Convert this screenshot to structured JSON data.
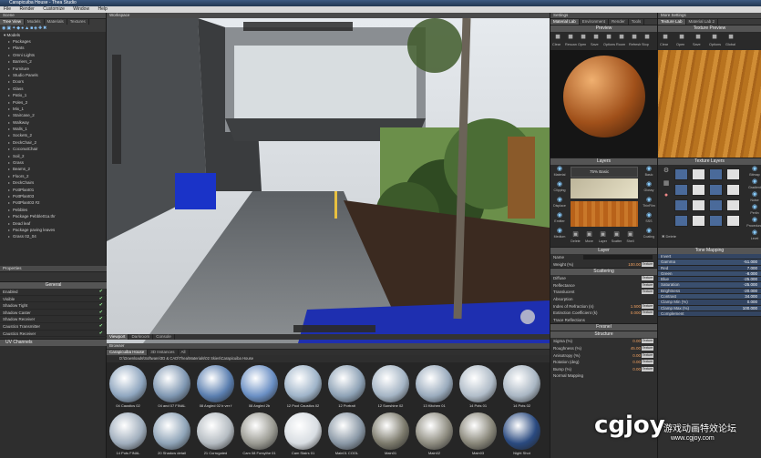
{
  "window": {
    "title": "Carapicuiba House - Thea Studio"
  },
  "menu": [
    "File",
    "Render",
    "Customize",
    "Window",
    "Help"
  ],
  "left": {
    "tabs": [
      "Tree View",
      "Models",
      "Materials",
      "Textures"
    ],
    "root": "Models",
    "items": [
      "Packages",
      "Plants",
      "Omni Lights",
      "Barriers_2",
      "Furniture",
      "Studio Panels",
      "Doors",
      "Glass",
      "Patio_1",
      "Poles_2",
      "Mix_1",
      "Staircase_2",
      "Walkway",
      "Walls_1",
      "Sockets_2",
      "DeckChair_2",
      "CoconutChair",
      "Soil_2",
      "Grass",
      "Beams_2",
      "Floors_2",
      "DeckChairs",
      "PottPlant01",
      "PottPlant03",
      "PottPlant03 #2",
      "Pebbles",
      "Package Pebble01a.thr",
      "Dead leaf",
      "Package paving leaves",
      "Grass 02_04"
    ],
    "properties_title": "Properties",
    "general_header": "General",
    "general": [
      "Enabled",
      "Visible",
      "Shadow Tight",
      "Shadow Caster",
      "Shadow Receiver",
      "Caustics Transmitter",
      "Caustics Receiver"
    ],
    "uv_title": "UV Channels"
  },
  "viewport": {
    "title": "Workspace",
    "tabs": [
      "Viewport",
      "Darkroom",
      "Console"
    ]
  },
  "browser": {
    "title": "Browser",
    "tabs": [
      "Carapicuiba House",
      "3D Instances",
      "All"
    ],
    "path": "D:\\Downloads\\Software\\3D & CAD\\Thea\\Materials\\02 Skies\\Carapicuiba House",
    "thumbs": [
      {
        "label": "04 Caustics 02",
        "color": "#8fa6bf"
      },
      {
        "label": "04 and 07 FINAL",
        "color": "#7f97b2"
      },
      {
        "label": "08 Angled 02 b ver f",
        "color": "#5b7fb0"
      },
      {
        "label": "08 Angled 2b",
        "color": "#6a8fc4"
      },
      {
        "label": "12 Pool Caustics 02",
        "color": "#9fb4c9"
      },
      {
        "label": "12 Portrait",
        "color": "#8ea2b6"
      },
      {
        "label": "12 Sunshine 02",
        "color": "#a4b4c4"
      },
      {
        "label": "13 Kitchen 01",
        "color": "#9aabbd"
      },
      {
        "label": "14 Pots 01",
        "color": "#b0bcc8"
      },
      {
        "label": "14 Pots 02",
        "color": "#a9b6c3"
      },
      {
        "label": "14 Pots FINAL",
        "color": "#a0aebd"
      },
      {
        "label": "20 Shadow detail",
        "color": "#8fa4b8"
      },
      {
        "label": "21 Corrugated",
        "color": "#b5bcc2"
      },
      {
        "label": "Cam 08 Forsythe 01",
        "color": "#9a9a92"
      },
      {
        "label": "Cam Stairs 01",
        "color": "#d8dde2"
      },
      {
        "label": "Main01 COOL",
        "color": "#8a98a6"
      },
      {
        "label": "Main01",
        "color": "#7c7a6c"
      },
      {
        "label": "Main02",
        "color": "#8e8c80"
      },
      {
        "label": "Main03",
        "color": "#888679"
      },
      {
        "label": "Night Shot",
        "color": "#2a4a80"
      }
    ]
  },
  "settings": {
    "title": "Settings",
    "tabs": [
      "Material Lab",
      "Environment",
      "Render",
      "Tools"
    ],
    "preview_title": "Preview",
    "preview_buttons": [
      "Clear",
      "Rescan",
      "Open",
      "Save",
      "Options",
      "Room",
      "Refresh",
      "Stop"
    ],
    "layers_title": "Layers",
    "layer_side_left": [
      "Material",
      "Clipping",
      "Displace",
      "Emitter",
      "Medium"
    ],
    "layer_side_right": [
      "Basic",
      "Glossy",
      "ThinFilm",
      "SSS",
      "Coating"
    ],
    "layer_bottom": [
      "Delete",
      "Move",
      "Layer",
      "Scatter",
      "Shell"
    ],
    "layer_name": "75% Basic",
    "layer_section": "Layer",
    "name_label": "Name",
    "weight_label": "Weight (%)",
    "weight_value": "100.00",
    "scattering_title": "Scattering",
    "scattering": [
      {
        "label": "Diffuse",
        "value": "",
        "tex": "Texture"
      },
      {
        "label": "Reflectance",
        "value": "",
        "tex": "Texture"
      },
      {
        "label": "Translucent",
        "value": "",
        "tex": "Texture"
      },
      {
        "label": "Absorption",
        "value": "",
        "tex": ""
      },
      {
        "label": "Index of Refraction (n)",
        "value": "1.500",
        "tex": "Texture"
      },
      {
        "label": "Extinction Coefficient (k)",
        "value": "0.000",
        "tex": "Texture"
      },
      {
        "label": "Trace Reflections",
        "value": "",
        "tex": ""
      }
    ],
    "fresnel_title": "Fresnel",
    "structure_title": "Structure",
    "structure": [
      {
        "label": "Sigma (%)",
        "value": "0.00",
        "tex": "Texture"
      },
      {
        "label": "Roughness (%)",
        "value": "45.00",
        "tex": "Texture"
      },
      {
        "label": "Anisotropy (%)",
        "value": "0.00",
        "tex": "Texture"
      },
      {
        "label": "Rotation (deg)",
        "value": "0.00",
        "tex": "Texture"
      },
      {
        "label": "Bump (%)",
        "value": "0.00",
        "tex": "Texture"
      },
      {
        "label": "Normal Mapping",
        "value": "",
        "tex": ""
      }
    ]
  },
  "texture": {
    "title": "More Settings",
    "tabs": [
      "Texture Lab",
      "Material Lab 2"
    ],
    "preview_title": "Texture Preview",
    "buttons": [
      "Clear",
      "Open",
      "Save",
      "Options",
      "Global"
    ],
    "layers_title": "Texture Layers",
    "side_right": [
      "Bitmap",
      "Gradient",
      "Noise",
      "Perlin",
      "Procedural",
      "Level"
    ],
    "delete_label": "Delete",
    "tone_title": "Tone Mapping",
    "tone": [
      {
        "label": "Invert",
        "value": ""
      },
      {
        "label": "Gamma",
        "value": "-51.000"
      },
      {
        "label": "Red",
        "value": "7.000"
      },
      {
        "label": "Green",
        "value": "-8.000"
      },
      {
        "label": "Blue",
        "value": "-25.000"
      },
      {
        "label": "Saturation",
        "value": "-25.000"
      },
      {
        "label": "Brightness",
        "value": "-20.000"
      },
      {
        "label": "Contrast",
        "value": "34.000"
      },
      {
        "label": "Clamp Min (%)",
        "value": "0.000"
      },
      {
        "label": "Clamp Max (%)",
        "value": "100.000"
      },
      {
        "label": "Complement",
        "value": ""
      }
    ]
  },
  "watermark": {
    "text": "cgjoy",
    "cn": "游戏动画特效论坛",
    "url": "www.cgjoy.com"
  }
}
